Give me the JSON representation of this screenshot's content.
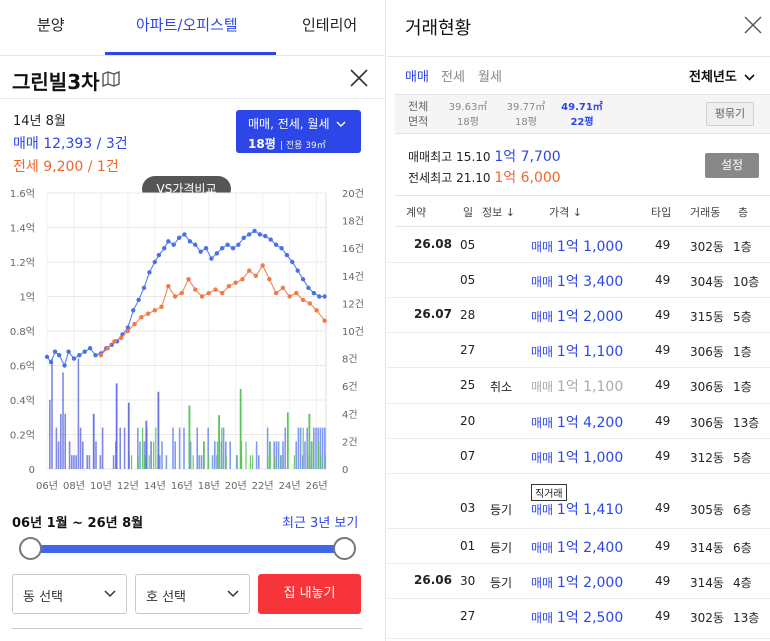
{
  "tabs": [
    {
      "label": "분양"
    },
    {
      "label": "아파트/오피스텔"
    },
    {
      "label": "인테리어"
    }
  ],
  "complex": {
    "name": "그린빌3차"
  },
  "summary": {
    "date": "14년 8월",
    "sale": "매매 12,393 / 3건",
    "jeonse": "전세 9,200 / 1건"
  },
  "filter": {
    "line1": "매매, 전세, 월세",
    "line2_main": "18평",
    "line2_sub": "전용 39㎡"
  },
  "vs_button": "VS가격비교",
  "chart_data": {
    "type": "line",
    "x_ticks": [
      "06년",
      "08년",
      "10년",
      "12년",
      "14년",
      "16년",
      "18년",
      "20년",
      "22년",
      "24년",
      "26년"
    ],
    "x_range": [
      2006,
      2026.7
    ],
    "y_left_ticks": [
      "0",
      "0.2억",
      "0.4억",
      "0.6억",
      "0.8억",
      "1억",
      "1.2억",
      "1.4억",
      "1.6억"
    ],
    "y_left_range": [
      0,
      1.6
    ],
    "y_right_ticks": [
      "0",
      "2건",
      "4건",
      "6건",
      "8건",
      "10건",
      "12건",
      "14건",
      "16건",
      "18건",
      "20건"
    ],
    "y_right_range": [
      0,
      20
    ],
    "series": [
      {
        "name": "매매",
        "color": "#4a72e8",
        "points": [
          [
            2006.0,
            0.65
          ],
          [
            2006.3,
            0.62
          ],
          [
            2006.6,
            0.68
          ],
          [
            2006.9,
            0.66
          ],
          [
            2007.3,
            0.6
          ],
          [
            2007.6,
            0.68
          ],
          [
            2008.0,
            0.64
          ],
          [
            2008.4,
            0.66
          ],
          [
            2008.8,
            0.68
          ],
          [
            2009.2,
            0.7
          ],
          [
            2009.6,
            0.66
          ],
          [
            2010.0,
            0.67
          ],
          [
            2010.4,
            0.7
          ],
          [
            2010.8,
            0.72
          ],
          [
            2011.2,
            0.74
          ],
          [
            2011.6,
            0.78
          ],
          [
            2012.0,
            0.82
          ],
          [
            2012.4,
            0.92
          ],
          [
            2012.8,
            0.98
          ],
          [
            2013.2,
            1.05
          ],
          [
            2013.6,
            1.14
          ],
          [
            2014.0,
            1.2
          ],
          [
            2014.3,
            1.24
          ],
          [
            2014.7,
            1.28
          ],
          [
            2015.0,
            1.32
          ],
          [
            2015.4,
            1.3
          ],
          [
            2015.8,
            1.34
          ],
          [
            2016.2,
            1.36
          ],
          [
            2016.6,
            1.32
          ],
          [
            2017.0,
            1.3
          ],
          [
            2017.4,
            1.26
          ],
          [
            2017.8,
            1.28
          ],
          [
            2018.2,
            1.22
          ],
          [
            2018.6,
            1.25
          ],
          [
            2019.0,
            1.28
          ],
          [
            2019.4,
            1.3
          ],
          [
            2019.8,
            1.28
          ],
          [
            2020.2,
            1.3
          ],
          [
            2020.6,
            1.34
          ],
          [
            2021.0,
            1.36
          ],
          [
            2021.4,
            1.38
          ],
          [
            2021.8,
            1.36
          ],
          [
            2022.2,
            1.35
          ],
          [
            2022.6,
            1.33
          ],
          [
            2023.0,
            1.3
          ],
          [
            2023.4,
            1.28
          ],
          [
            2023.8,
            1.24
          ],
          [
            2024.2,
            1.2
          ],
          [
            2024.6,
            1.15
          ],
          [
            2025.0,
            1.1
          ],
          [
            2025.4,
            1.05
          ],
          [
            2025.8,
            1.02
          ],
          [
            2026.2,
            1.0
          ],
          [
            2026.6,
            1.0
          ]
        ]
      },
      {
        "name": "전세",
        "color": "#f07a45",
        "points": [
          [
            2010.0,
            0.66
          ],
          [
            2010.5,
            0.7
          ],
          [
            2011.0,
            0.74
          ],
          [
            2011.5,
            0.76
          ],
          [
            2012.0,
            0.8
          ],
          [
            2012.5,
            0.84
          ],
          [
            2013.0,
            0.88
          ],
          [
            2013.5,
            0.9
          ],
          [
            2014.0,
            0.92
          ],
          [
            2014.5,
            0.94
          ],
          [
            2015.0,
            1.06
          ],
          [
            2015.5,
            1.0
          ],
          [
            2016.0,
            1.02
          ],
          [
            2016.5,
            1.1
          ],
          [
            2017.0,
            1.04
          ],
          [
            2017.5,
            1.0
          ],
          [
            2018.0,
            1.02
          ],
          [
            2018.5,
            1.04
          ],
          [
            2019.0,
            1.02
          ],
          [
            2019.5,
            1.06
          ],
          [
            2020.0,
            1.08
          ],
          [
            2020.5,
            1.1
          ],
          [
            2021.0,
            1.15
          ],
          [
            2021.5,
            1.12
          ],
          [
            2022.0,
            1.18
          ],
          [
            2022.5,
            1.1
          ],
          [
            2023.0,
            1.02
          ],
          [
            2023.5,
            1.05
          ],
          [
            2024.0,
            1.0
          ],
          [
            2024.5,
            1.02
          ],
          [
            2025.0,
            0.98
          ],
          [
            2025.5,
            0.96
          ],
          [
            2026.0,
            0.92
          ],
          [
            2026.6,
            0.86
          ]
        ]
      }
    ]
  },
  "range": {
    "label": "06년 1월 ~ 26년 8월",
    "recent": "최근 3년 보기"
  },
  "selects": {
    "dong": "동 선택",
    "ho": "호 선택"
  },
  "list_button": "집 내놓기",
  "right": {
    "title": "거래현황",
    "trade_tabs": [
      "매매",
      "전세",
      "월세"
    ],
    "year_select": "전체년도",
    "area_label_1": "전체",
    "area_label_2": "면적",
    "areas": [
      {
        "m2": "39.63㎡",
        "py": "18평"
      },
      {
        "m2": "39.77㎡",
        "py": "18평"
      },
      {
        "m2": "49.71㎡",
        "py": "22평"
      }
    ],
    "pyeong_button": "평묶기",
    "max_sale": {
      "label": "매매최고",
      "date": "15.10",
      "price": "1억 7,700"
    },
    "max_rent": {
      "label": "전세최고",
      "date": "21.10",
      "price": "1억 6,000"
    },
    "setting_button": "설정",
    "headers": {
      "contract": "계약",
      "day": "일",
      "info": "정보 ↓",
      "price": "가격 ↓",
      "type": "타입",
      "dong": "거래동",
      "floor": "층"
    },
    "rows": [
      {
        "month": "26.08",
        "day": "05",
        "info": "",
        "badge": "",
        "kind": "매매",
        "price": "1억 1,000",
        "cancel": false,
        "type": "49",
        "dong": "302동",
        "floor": "1층"
      },
      {
        "month": "",
        "day": "05",
        "info": "",
        "badge": "",
        "kind": "매매",
        "price": "1억 3,400",
        "cancel": false,
        "type": "49",
        "dong": "304동",
        "floor": "10층"
      },
      {
        "month": "26.07",
        "day": "28",
        "info": "",
        "badge": "",
        "kind": "매매",
        "price": "1억 2,000",
        "cancel": false,
        "type": "49",
        "dong": "315동",
        "floor": "5층"
      },
      {
        "month": "",
        "day": "27",
        "info": "",
        "badge": "",
        "kind": "매매",
        "price": "1억 1,100",
        "cancel": false,
        "type": "49",
        "dong": "306동",
        "floor": "1층"
      },
      {
        "month": "",
        "day": "25",
        "info": "취소",
        "badge": "",
        "kind": "매매",
        "price": "1억 1,100",
        "cancel": true,
        "type": "49",
        "dong": "306동",
        "floor": "1층"
      },
      {
        "month": "",
        "day": "20",
        "info": "",
        "badge": "",
        "kind": "매매",
        "price": "1억 4,200",
        "cancel": false,
        "type": "49",
        "dong": "306동",
        "floor": "13층"
      },
      {
        "month": "",
        "day": "07",
        "info": "",
        "badge": "",
        "kind": "매매",
        "price": "1억 1,000",
        "cancel": false,
        "type": "49",
        "dong": "312동",
        "floor": "5층"
      },
      {
        "month": "",
        "day": "03",
        "info": "등기",
        "badge": "직거래",
        "kind": "매매",
        "price": "1억 1,410",
        "cancel": false,
        "type": "49",
        "dong": "305동",
        "floor": "6층"
      },
      {
        "month": "",
        "day": "01",
        "info": "등기",
        "badge": "",
        "kind": "매매",
        "price": "1억 2,400",
        "cancel": false,
        "type": "49",
        "dong": "314동",
        "floor": "6층"
      },
      {
        "month": "26.06",
        "day": "30",
        "info": "등기",
        "badge": "",
        "kind": "매매",
        "price": "1억 2,000",
        "cancel": false,
        "type": "49",
        "dong": "314동",
        "floor": "4층"
      },
      {
        "month": "",
        "day": "27",
        "info": "",
        "badge": "",
        "kind": "매매",
        "price": "1억 2,500",
        "cancel": false,
        "type": "49",
        "dong": "302동",
        "floor": "13층"
      }
    ]
  }
}
